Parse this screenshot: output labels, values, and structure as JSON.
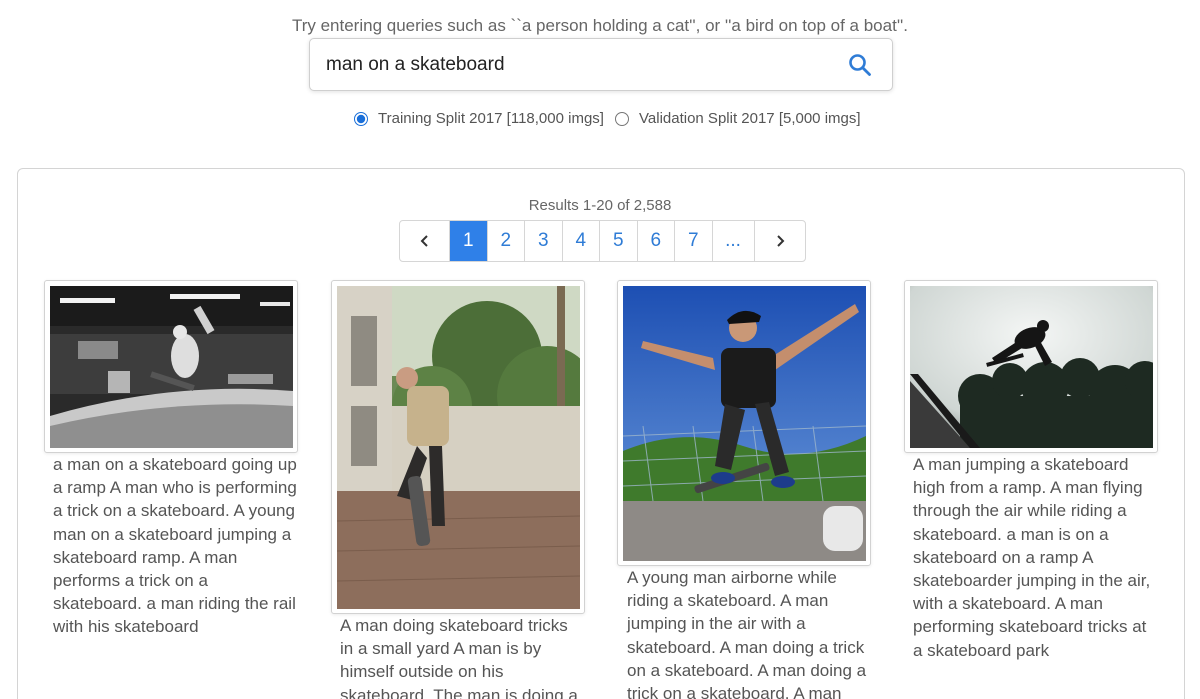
{
  "hint": "Try entering queries such as ``a person holding a cat'', or ''a bird on top of a boat''.",
  "search": {
    "value": "man on a skateboard"
  },
  "splits": [
    {
      "label": "Training Split 2017 [118,000 imgs]",
      "checked": true
    },
    {
      "label": "Validation Split 2017 [5,000 imgs]",
      "checked": false
    }
  ],
  "results_count": "Results 1-20 of 2,588",
  "pagination": {
    "prev": "‹",
    "pages": [
      "1",
      "2",
      "3",
      "4",
      "5",
      "6",
      "7"
    ],
    "active": "1",
    "ellipsis": "...",
    "next": "›"
  },
  "results": [
    {
      "image": "black-and-white photo of skateboarder on indoor ramp",
      "caption": "a man on a skateboard going up a ramp A man who is performing a trick on a skateboard. A young man on a skateboard jumping a skateboard ramp. A man performs a trick on a skateboard. a man riding the rail with his skateboard"
    },
    {
      "image": "man kicking skateboard in backyard",
      "caption": "A man doing skateboard tricks in a small yard A man is by himself outside on his skateboard. The man is doing a trick on his"
    },
    {
      "image": "young man airborne on skateboard under blue sky",
      "caption": "A young man airborne while riding a skateboard. A man jumping in the air with a skateboard. A man doing a trick on a skateboard. A man doing a trick on a skateboard. A man and"
    },
    {
      "image": "skateboarder silhouette in the air above ramp and trees",
      "caption": "A man jumping a skateboard high from a ramp. A man flying through the air while riding a skateboard. a man is on a skateboard on a ramp A skateboarder jumping in the air, with a skateboard. A man performing skateboard tricks at a skateboard park"
    }
  ],
  "colors": {
    "accent": "#2f80e8",
    "link": "#2f7cd6"
  }
}
